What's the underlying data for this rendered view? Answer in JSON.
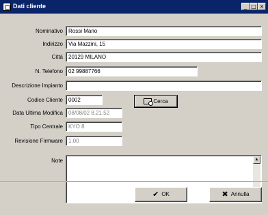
{
  "window": {
    "title": "Dati cliente"
  },
  "titlebar_buttons": {
    "minimize": "_",
    "maximize": "□",
    "close": "×"
  },
  "form": {
    "nominativo": {
      "label": "Nominativo",
      "value": "Rossi Mario"
    },
    "indirizzo": {
      "label": "Indirizzo",
      "value": "Via Mazzini, 15"
    },
    "citta": {
      "label": "Città",
      "value": "20129 MILANO"
    },
    "telefono": {
      "label": "N. Telefono",
      "value": "02 99887766"
    },
    "descrizione": {
      "label": "Descrizione Impianto",
      "value": ""
    },
    "codice": {
      "label": "Codice Cliente",
      "value": "0002"
    },
    "ultima_modifica": {
      "label": "Data Ultima Modifica",
      "value": "08/08/02 8.21.52"
    },
    "tipo_centrale": {
      "label": "Tipo Centrale",
      "value": "KYO 8"
    },
    "revisione": {
      "label": "Revisione Firmware",
      "value": "1.00"
    },
    "note": {
      "label": "Note",
      "value": ""
    }
  },
  "buttons": {
    "cerca": "Cerca",
    "ok": "OK",
    "annulla": "Annulla"
  },
  "icons": {
    "search": "search-icon",
    "ok": "checkmark-icon",
    "cancel": "x-icon"
  }
}
